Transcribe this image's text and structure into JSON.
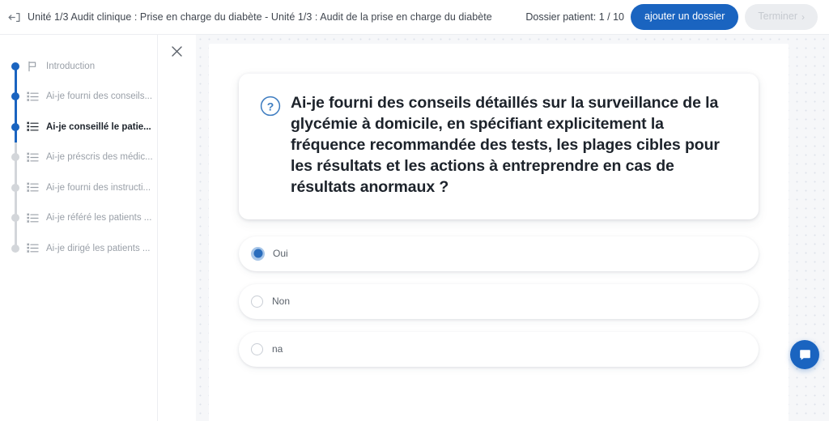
{
  "header": {
    "back_icon": "back-arrow-icon",
    "breadcrumb": "Unité 1/3 Audit clinique : Prise en charge du diabète - Unité 1/3 : Audit de la prise en charge du diabète",
    "patient_count_label": "Dossier patient: 1 / 10",
    "add_record_label": "ajouter un dossier",
    "finish_label": "Terminer",
    "finish_chevron": "›",
    "accent_color": "#1a64c0",
    "disabled_color": "#ebedf0"
  },
  "sidebar": {
    "close_icon": "close-icon",
    "items": [
      {
        "label": "Introduction",
        "icon": "flag-icon",
        "state": "done",
        "current": false
      },
      {
        "label": "Ai-je fourni des conseils...",
        "icon": "checklist-icon",
        "state": "done",
        "current": false
      },
      {
        "label": "Ai-je conseillé le patie...",
        "icon": "checklist-icon",
        "state": "done",
        "current": true
      },
      {
        "label": "Ai-je préscris des médic...",
        "icon": "checklist-icon",
        "state": "todo",
        "current": false
      },
      {
        "label": "Ai-je fourni des instructi...",
        "icon": "checklist-icon",
        "state": "todo",
        "current": false
      },
      {
        "label": "Ai-je référé les patients ...",
        "icon": "checklist-icon",
        "state": "todo",
        "current": false
      },
      {
        "label": "Ai-je dirigé les patients ...",
        "icon": "checklist-icon",
        "state": "todo",
        "current": false
      }
    ]
  },
  "question": {
    "icon": "question-mark-circle-icon",
    "text": "Ai-je fourni des conseils détaillés sur la surveillance de la glycémie à domicile, en spécifiant explicitement la fréquence recommandée des tests, les plages cibles pour les résultats et les actions à entreprendre en cas de résultats anormaux ?",
    "options": [
      {
        "label": "Oui",
        "selected": true
      },
      {
        "label": "Non",
        "selected": false
      },
      {
        "label": "na",
        "selected": false
      }
    ]
  },
  "chat_widget": {
    "icon": "chat-bubble-icon",
    "color": "#1a64c0"
  }
}
